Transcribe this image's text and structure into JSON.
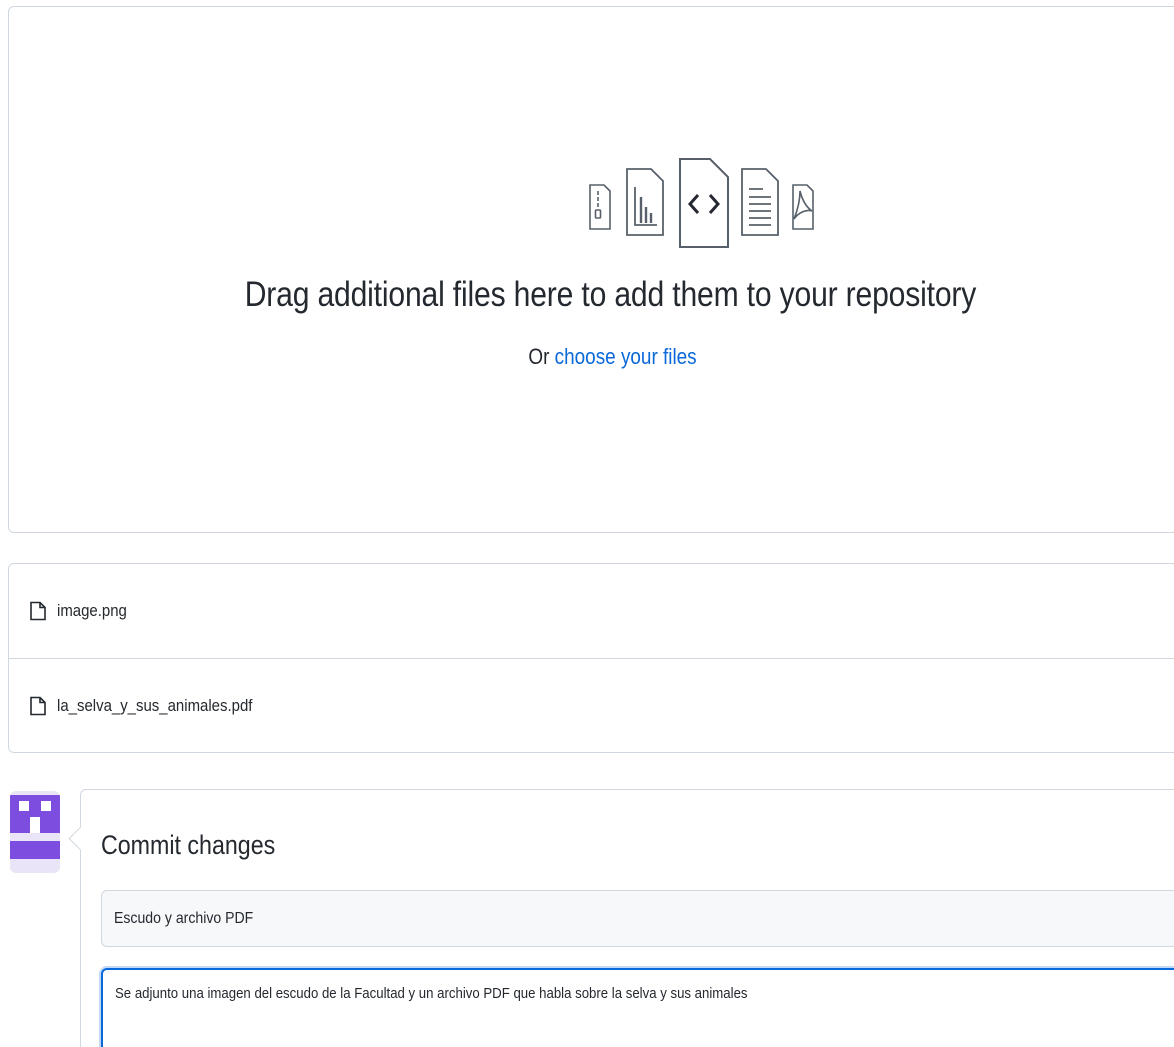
{
  "dropzone": {
    "icons": [
      "zip-file-icon",
      "chart-file-icon",
      "code-file-icon",
      "text-file-icon",
      "pdf-file-icon"
    ],
    "title": "Drag additional files here to add them to your repository",
    "sub_prefix": "Or",
    "sub_link": "choose your files"
  },
  "files": [
    {
      "name": "image.png"
    },
    {
      "name": "la_selva_y_sus_animales.pdf"
    }
  ],
  "commit": {
    "title": "Commit changes",
    "summary": "Escudo y archivo PDF",
    "description": "Se adjunto una imagen del escudo de la Facultad y un archivo PDF que habla sobre la selva y sus animales"
  },
  "colors": {
    "link": "#0969da",
    "border": "#d0d7de",
    "avatar_purple": "#7c4dde"
  }
}
